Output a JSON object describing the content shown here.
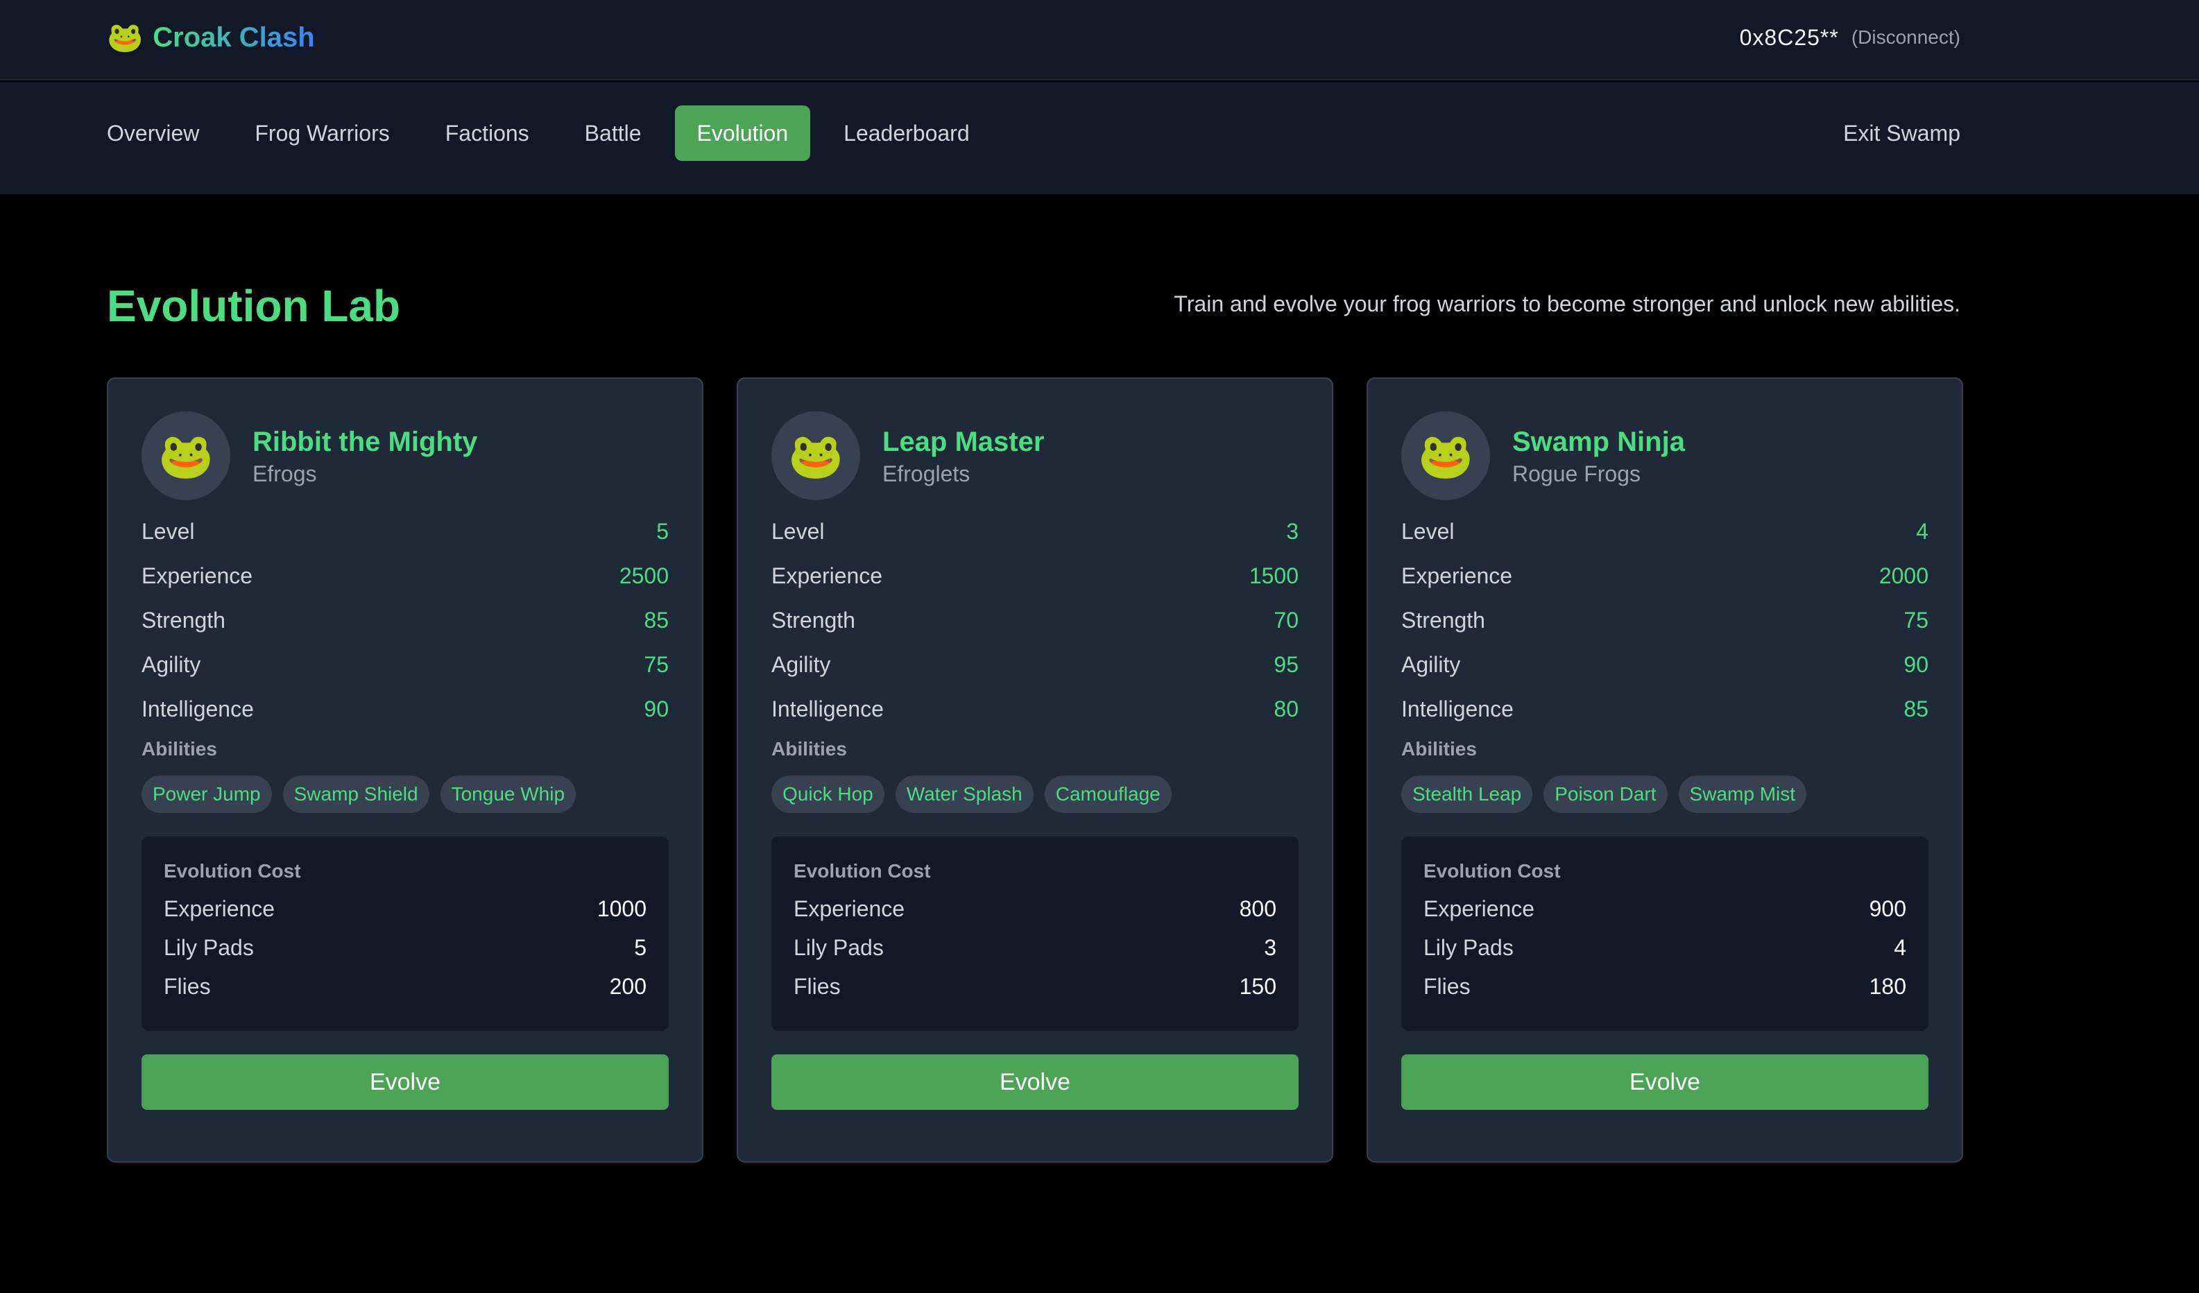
{
  "brand": {
    "icon": "🐸",
    "name": "Croak Clash"
  },
  "wallet": {
    "address": "0x8C25**",
    "disconnect_label": "(Disconnect)"
  },
  "nav": {
    "items": [
      {
        "label": "Overview"
      },
      {
        "label": "Frog Warriors"
      },
      {
        "label": "Factions"
      },
      {
        "label": "Battle"
      },
      {
        "label": "Evolution",
        "active": true
      },
      {
        "label": "Leaderboard"
      }
    ],
    "exit_label": "Exit Swamp"
  },
  "main": {
    "title": "Evolution Lab",
    "subtitle": "Train and evolve your frog warriors to become stronger and unlock new abilities.",
    "abilities_heading": "Abilities",
    "cost_heading": "Evolution Cost",
    "evolve_label": "Evolve",
    "cards": [
      {
        "avatar": "🐸",
        "name": "Ribbit the Mighty",
        "faction": "Efrogs",
        "stats": [
          {
            "label": "Level",
            "value": "5"
          },
          {
            "label": "Experience",
            "value": "2500"
          },
          {
            "label": "Strength",
            "value": "85"
          },
          {
            "label": "Agility",
            "value": "75"
          },
          {
            "label": "Intelligence",
            "value": "90"
          }
        ],
        "abilities": [
          "Power Jump",
          "Swamp Shield",
          "Tongue Whip"
        ],
        "cost": [
          {
            "label": "Experience",
            "value": "1000"
          },
          {
            "label": "Lily Pads",
            "value": "5"
          },
          {
            "label": "Flies",
            "value": "200"
          }
        ]
      },
      {
        "avatar": "🐸",
        "name": "Leap Master",
        "faction": "Efroglets",
        "stats": [
          {
            "label": "Level",
            "value": "3"
          },
          {
            "label": "Experience",
            "value": "1500"
          },
          {
            "label": "Strength",
            "value": "70"
          },
          {
            "label": "Agility",
            "value": "95"
          },
          {
            "label": "Intelligence",
            "value": "80"
          }
        ],
        "abilities": [
          "Quick Hop",
          "Water Splash",
          "Camouflage"
        ],
        "cost": [
          {
            "label": "Experience",
            "value": "800"
          },
          {
            "label": "Lily Pads",
            "value": "3"
          },
          {
            "label": "Flies",
            "value": "150"
          }
        ]
      },
      {
        "avatar": "🐸",
        "name": "Swamp Ninja",
        "faction": "Rogue Frogs",
        "stats": [
          {
            "label": "Level",
            "value": "4"
          },
          {
            "label": "Experience",
            "value": "2000"
          },
          {
            "label": "Strength",
            "value": "75"
          },
          {
            "label": "Agility",
            "value": "90"
          },
          {
            "label": "Intelligence",
            "value": "85"
          }
        ],
        "abilities": [
          "Stealth Leap",
          "Poison Dart",
          "Swamp Mist"
        ],
        "cost": [
          {
            "label": "Experience",
            "value": "900"
          },
          {
            "label": "Lily Pads",
            "value": "4"
          },
          {
            "label": "Flies",
            "value": "180"
          }
        ]
      }
    ]
  },
  "colors": {
    "accent_green": "#4ade80",
    "button_green": "#4ca556",
    "brand_blue": "#3b82f6",
    "panel": "#1f2937",
    "header": "#111827",
    "background": "#000000"
  }
}
